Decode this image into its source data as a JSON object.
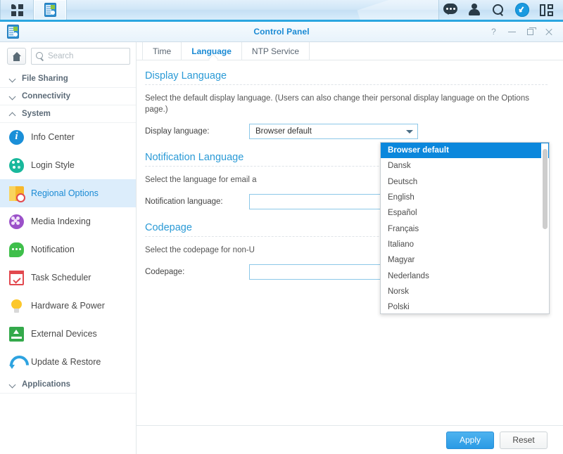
{
  "taskbar": {
    "main_menu_icon": "grid-icon",
    "app_icon": "control-panel-icon",
    "tray": [
      {
        "name": "chat-icon"
      },
      {
        "name": "user-icon"
      },
      {
        "name": "search-icon"
      },
      {
        "name": "notification-icon"
      },
      {
        "name": "widget-icon"
      }
    ]
  },
  "window": {
    "title": "Control Panel",
    "controls": {
      "help": "?",
      "minimize": "–",
      "maximize": "□",
      "close": "×"
    }
  },
  "sidebar": {
    "home_label": "Home",
    "search": {
      "value": "",
      "placeholder": "Search"
    },
    "sections": [
      {
        "label": "File Sharing",
        "expanded": false
      },
      {
        "label": "Connectivity",
        "expanded": false
      },
      {
        "label": "System",
        "expanded": true
      },
      {
        "label": "Applications",
        "expanded": false
      }
    ],
    "items": [
      {
        "label": "Info Center",
        "icon": "info-icon",
        "selected": false
      },
      {
        "label": "Login Style",
        "icon": "palette-icon",
        "selected": false
      },
      {
        "label": "Regional Options",
        "icon": "regional-options-icon",
        "selected": true
      },
      {
        "label": "Media Indexing",
        "icon": "media-indexing-icon",
        "selected": false
      },
      {
        "label": "Notification",
        "icon": "notification-icon",
        "selected": false
      },
      {
        "label": "Task Scheduler",
        "icon": "task-scheduler-icon",
        "selected": false
      },
      {
        "label": "Hardware & Power",
        "icon": "bulb-icon",
        "selected": false
      },
      {
        "label": "External Devices",
        "icon": "external-devices-icon",
        "selected": false
      },
      {
        "label": "Update & Restore",
        "icon": "update-restore-icon",
        "selected": false
      }
    ]
  },
  "main": {
    "tabs": [
      {
        "label": "Time",
        "active": false
      },
      {
        "label": "Language",
        "active": true
      },
      {
        "label": "NTP Service",
        "active": false
      }
    ],
    "groups": [
      {
        "title": "Display Language",
        "description": "Select the default display language. (Users can also change their personal display language on the Options page.)",
        "field_label": "Display language:",
        "field_value": "Browser default"
      },
      {
        "title": "Notification Language",
        "description": "Select the language for email a",
        "field_label": "Notification language:",
        "field_value": ""
      },
      {
        "title": "Codepage",
        "description": "Select the codepage for non-U",
        "field_label": "Codepage:",
        "field_value": ""
      }
    ],
    "dropdown": {
      "open": true,
      "selected": "Browser default",
      "options": [
        "Browser default",
        "Dansk",
        "Deutsch",
        "English",
        "Español",
        "Français",
        "Italiano",
        "Magyar",
        "Nederlands",
        "Norsk",
        "Polski"
      ]
    }
  },
  "footer": {
    "apply_label": "Apply",
    "reset_label": "Reset"
  },
  "colors": {
    "accent": "#1a8ad4",
    "dropdown_highlight": "#0b87dc",
    "sidebar_selected_bg": "#dcedfb",
    "apply_button": "#2a9ae5",
    "taskbar_border": "#2ba6e0"
  }
}
